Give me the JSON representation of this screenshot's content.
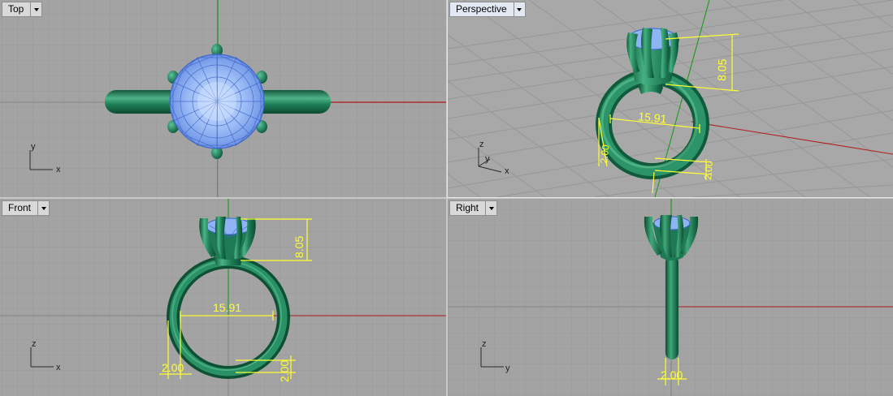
{
  "viewports": {
    "top": {
      "label": "Top",
      "axis_labels": {
        "vertical": "y",
        "horizontal": "x"
      }
    },
    "perspective": {
      "label": "Perspective",
      "axis_labels": {
        "vertical": "z",
        "depth": "y",
        "horizontal": "x"
      }
    },
    "front": {
      "label": "Front",
      "axis_labels": {
        "vertical": "z",
        "horizontal": "x"
      }
    },
    "right": {
      "label": "Right",
      "axis_labels": {
        "vertical": "z",
        "horizontal": "y"
      }
    }
  },
  "dimensions": {
    "height": "8.05",
    "inner_diameter": "15.91",
    "band_width": "2.00",
    "band_thickness": "2.00"
  },
  "icons": {
    "dropdown": "chevron-down-icon"
  },
  "colors": {
    "viewport_bg": "#a3a3a3",
    "grid_minor": "#9a9a9a",
    "grid_major": "#8a8a8a",
    "metal": "#1e7a55",
    "gem": "#8fb4f5",
    "dimension": "#ffff33",
    "x_axis": "#b02020",
    "y_axis": "#1e9a1e"
  }
}
